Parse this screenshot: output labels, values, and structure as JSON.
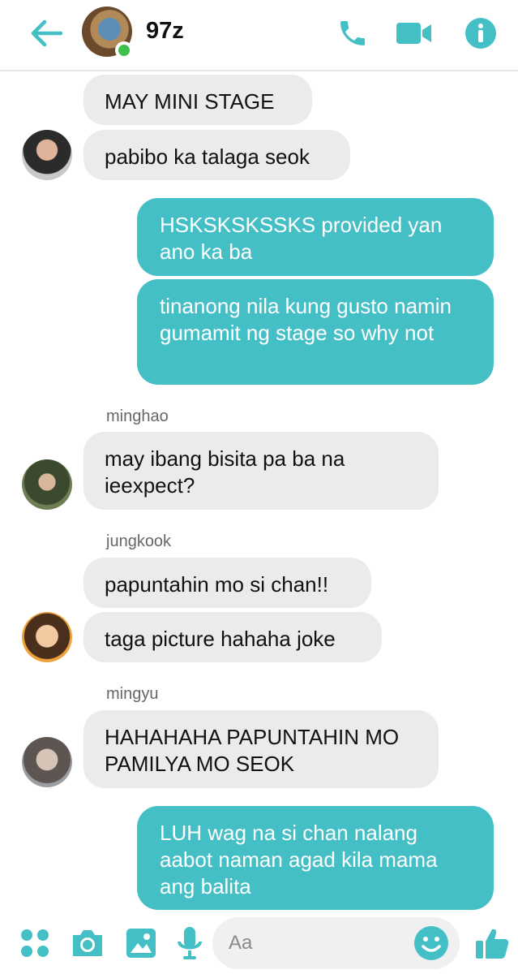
{
  "header": {
    "title": "97z",
    "back_icon": "arrow-left-icon",
    "call_icon": "phone-icon",
    "video_icon": "video-camera-icon",
    "info_icon": "info-icon",
    "accent": "#45bfc6",
    "online_color": "#3cc14d"
  },
  "messages": [
    {
      "text": "MAY MINI STAGE",
      "direction": "incoming"
    },
    {
      "text": "pabibo ka talaga seok",
      "direction": "incoming"
    },
    {
      "text": "HSKSKSKSSKS provided yan ano ka ba",
      "direction": "outgoing"
    },
    {
      "text": "tinanong nila kung gusto namin gumamit ng stage so why not",
      "direction": "outgoing"
    },
    {
      "sender": "minghao",
      "text": "may ibang bisita pa ba na ieexpect?",
      "direction": "incoming"
    },
    {
      "sender": "jungkook",
      "text": "papuntahin mo si chan!!",
      "direction": "incoming"
    },
    {
      "text": "taga picture hahaha joke",
      "direction": "incoming"
    },
    {
      "sender": "mingyu",
      "text": "HAHAHAHA PAPUNTAHIN MO PAMILYA MO SEOK",
      "direction": "incoming"
    },
    {
      "text": "LUH wag na si chan nalang aabot naman agad kila mama ang balita",
      "direction": "outgoing"
    }
  ],
  "composer": {
    "placeholder": "Aa",
    "icons": [
      "apps-icon",
      "camera-icon",
      "image-icon",
      "microphone-icon",
      "emoji-icon",
      "thumbs-up-icon"
    ]
  },
  "colors": {
    "outgoing_bubble": "#45bfc6",
    "incoming_bubble": "#ebebeb"
  }
}
